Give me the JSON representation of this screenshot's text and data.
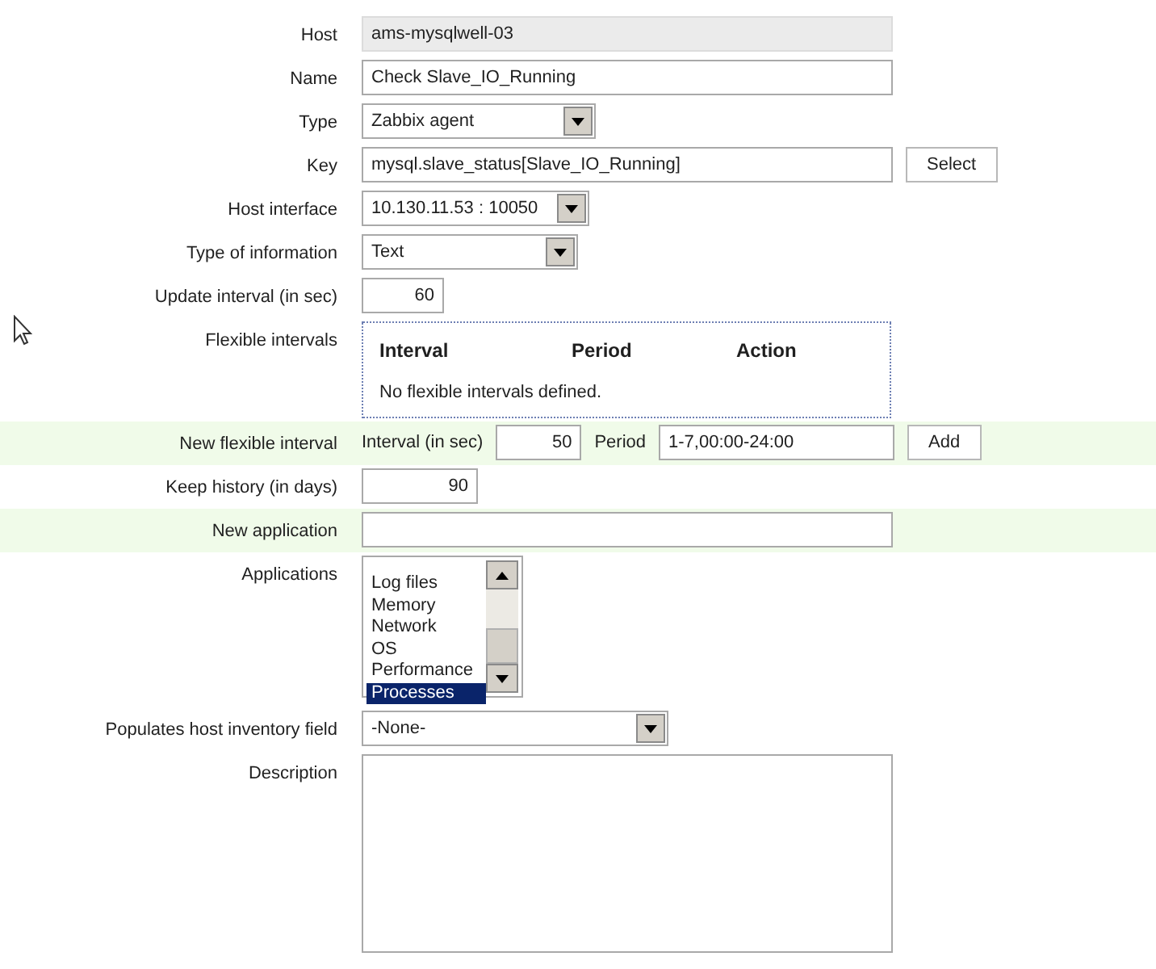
{
  "form": [
    {
      "kind": "static",
      "label": "Host",
      "value": "ams-mysqlwell-03",
      "highlighted": false
    },
    {
      "kind": "text",
      "label": "Name",
      "value": "Check Slave_IO_Running",
      "highlighted": false
    },
    {
      "kind": "select",
      "label": "Type",
      "value": "Zabbix agent",
      "highlighted": false
    },
    {
      "kind": "text_button",
      "label": "Key",
      "value": "mysql.slave_status[Slave_IO_Running]",
      "button": "Select",
      "highlighted": false
    },
    {
      "kind": "select",
      "label": "Host interface",
      "value": "10.130.11.53 : 10050",
      "highlighted": false
    },
    {
      "kind": "select",
      "label": "Type of information",
      "value": "Text",
      "highlighted": false
    },
    {
      "kind": "number",
      "label": "Update interval (in sec)",
      "value": "60",
      "highlighted": false
    },
    {
      "kind": "flex_table",
      "label": "Flexible intervals",
      "columns": [
        "Interval",
        "Period",
        "Action"
      ],
      "empty": "No flexible intervals defined.",
      "highlighted": false
    },
    {
      "kind": "flex_new",
      "label": "New flexible interval",
      "interval_label": "Interval (in sec)",
      "interval": "50",
      "period_label": "Period",
      "period": "1-7,00:00-24:00",
      "button": "Add",
      "highlighted": true
    },
    {
      "kind": "number",
      "label": "Keep history (in days)",
      "value": "90",
      "highlighted": false
    },
    {
      "kind": "text",
      "label": "New application",
      "highlighted": true
    },
    {
      "kind": "listbox",
      "label": "Applications",
      "items": [
        {
          "label": "Log files",
          "selected": false
        },
        {
          "label": "Memory",
          "selected": false
        },
        {
          "label": "Network",
          "selected": false
        },
        {
          "label": "OS",
          "selected": false
        },
        {
          "label": "Performance",
          "selected": false
        },
        {
          "label": "Processes",
          "selected": true
        }
      ],
      "highlighted": false
    },
    {
      "kind": "select",
      "label": "Populates host inventory field",
      "value": "-None-",
      "highlighted": false
    },
    {
      "kind": "textarea",
      "label": "Description",
      "highlighted": false
    }
  ]
}
